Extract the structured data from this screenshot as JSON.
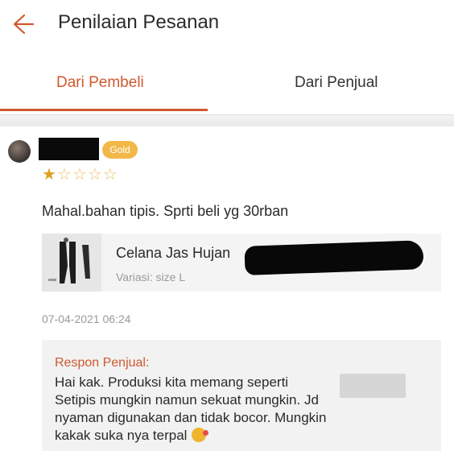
{
  "header": {
    "title": "Penilaian Pesanan",
    "back_icon": "back-arrow-icon"
  },
  "tabs": [
    {
      "label": "Dari Pembeli",
      "active": true
    },
    {
      "label": "Dari Penjual",
      "active": false
    }
  ],
  "review": {
    "badge": "Gold",
    "rating": 1,
    "max_rating": 5,
    "text": "Mahal.bahan tipis. Sprti beli yg 30rban",
    "product": {
      "name": "Celana Jas Hujan",
      "variant": "Variasi: size L"
    },
    "timestamp": "07-04-2021 06:24",
    "seller_response": {
      "label": "Respon Penjual:",
      "lines": [
        "Hai kak. Produksi kita memang seperti",
        "Setipis mungkin namun sekuat mungkin. Jd",
        "nyaman digunakan dan tidak bocor. Mungkin",
        "kakak suka nya terpal"
      ]
    }
  },
  "colors": {
    "accent": "#d0582f",
    "badge": "#f2b84a",
    "star": "#e0a020"
  }
}
